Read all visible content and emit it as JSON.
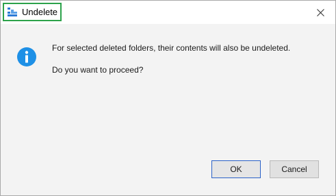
{
  "window": {
    "title": "Undelete",
    "app_icon": "undelete-app-icon",
    "close_icon": "close-icon",
    "highlight_color": "#2ca24a"
  },
  "message": {
    "icon": "info-icon",
    "icon_color": "#1e90e6",
    "line1": "For selected deleted folders, their contents will also be undeleted.",
    "line2": "Do you want to proceed?"
  },
  "buttons": {
    "ok_label": "OK",
    "cancel_label": "Cancel"
  }
}
